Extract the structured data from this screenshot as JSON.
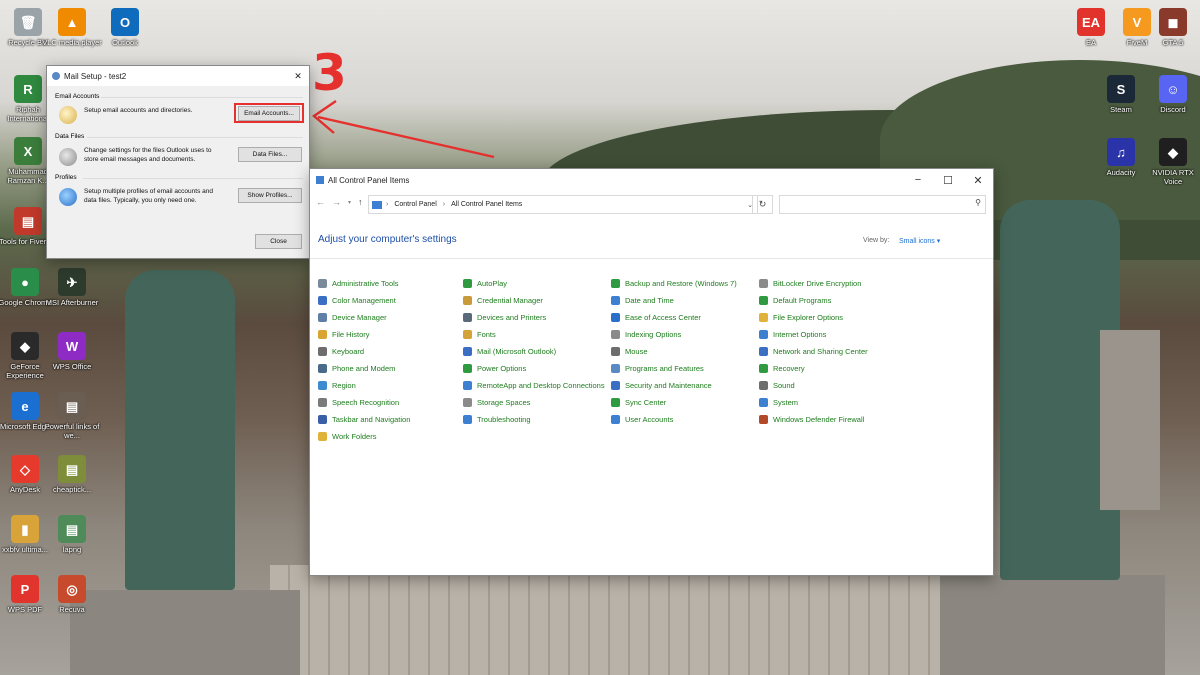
{
  "desktop": {
    "icons_left": [
      {
        "label": "Recycle Bin",
        "color": "#9aa3a8",
        "glyph": "🗑"
      },
      {
        "label": "VLC media player",
        "color": "#f08a00",
        "glyph": "▲"
      },
      {
        "label": "Outlook",
        "color": "#0f6cbd",
        "glyph": "O"
      },
      {
        "label": "Riphah International",
        "color": "#2f8a3f",
        "glyph": "R"
      },
      {
        "label": "Muhammad Ramzan K...",
        "color": "#3b7d3b",
        "glyph": "X"
      },
      {
        "label": "Tools for Fiverr ...",
        "color": "#c0392b",
        "glyph": "▤"
      },
      {
        "label": "Google Chrome",
        "color": "#2a8d4a",
        "glyph": "●"
      },
      {
        "label": "MSI Afterburner",
        "color": "#2d3b2d",
        "glyph": "✈"
      },
      {
        "label": "GeForce Experience",
        "color": "#2a2a2a",
        "glyph": "◆"
      },
      {
        "label": "WPS Office",
        "color": "#8e2bc4",
        "glyph": "W"
      },
      {
        "label": "Microsoft Edge",
        "color": "#1b6fd1",
        "glyph": "e"
      },
      {
        "label": "Powerful links of we...",
        "color": "#6a5d52",
        "glyph": "▤"
      },
      {
        "label": "AnyDesk",
        "color": "#e53a2c",
        "glyph": "◇"
      },
      {
        "label": "cheaptick...",
        "color": "#7e8d3a",
        "glyph": "▤"
      },
      {
        "label": "xxbfv ultima...",
        "color": "#d8a43a",
        "glyph": "▮"
      },
      {
        "label": "lapng",
        "color": "#4e8b58",
        "glyph": "▤"
      },
      {
        "label": "WPS PDF",
        "color": "#e0342c",
        "glyph": "P"
      },
      {
        "label": "Recuva",
        "color": "#c84a2c",
        "glyph": "◎"
      }
    ],
    "icons_right": [
      {
        "label": "EA",
        "color": "#e1322b",
        "glyph": "EA"
      },
      {
        "label": "FiveM",
        "color": "#f59a1e",
        "glyph": "V"
      },
      {
        "label": "GTA 5",
        "color": "#8a3a2a",
        "glyph": "◼"
      },
      {
        "label": "Steam",
        "color": "#1b2838",
        "glyph": "S"
      },
      {
        "label": "Discord",
        "color": "#5865f2",
        "glyph": "☺"
      },
      {
        "label": "Audacity",
        "color": "#2a34a8",
        "glyph": "♫"
      },
      {
        "label": "NVIDIA RTX Voice",
        "color": "#1f1f1f",
        "glyph": "◆"
      }
    ]
  },
  "annotation": {
    "number": "3",
    "color": "#e5302e"
  },
  "mail_setup": {
    "title": "Mail Setup - test2",
    "close_glyph": "✕",
    "email_accounts": {
      "heading": "Email Accounts",
      "desc": "Setup email accounts and directories.",
      "button": "Email Accounts..."
    },
    "data_files": {
      "heading": "Data Files",
      "desc_line1": "Change settings for the files Outlook uses to",
      "desc_line2": "store email messages and documents.",
      "button": "Data Files..."
    },
    "profiles": {
      "heading": "Profiles",
      "desc_line1": "Setup multiple profiles of email accounts and",
      "desc_line2": "data files. Typically, you only need one.",
      "button": "Show Profiles..."
    },
    "close_button": "Close"
  },
  "control_panel": {
    "title": "All Control Panel Items",
    "breadcrumb": [
      "Control Panel",
      "All Control Panel Items"
    ],
    "heading": "Adjust your computer's settings",
    "view_by_label": "View by:",
    "view_by_value": "Small icons ▾",
    "columns": [
      [
        {
          "label": "Administrative Tools",
          "color": "#7a8a9a"
        },
        {
          "label": "Color Management",
          "color": "#3a6fc4"
        },
        {
          "label": "Device Manager",
          "color": "#5f7fa8"
        },
        {
          "label": "File History",
          "color": "#d9a532"
        },
        {
          "label": "Keyboard",
          "color": "#6d6d6d"
        },
        {
          "label": "Phone and Modem",
          "color": "#4a6a8a"
        },
        {
          "label": "Region",
          "color": "#3d8ad1"
        },
        {
          "label": "Speech Recognition",
          "color": "#7a7a7a"
        },
        {
          "label": "Taskbar and Navigation",
          "color": "#3a5fa8"
        },
        {
          "label": "Work Folders",
          "color": "#e0b23a"
        }
      ],
      [
        {
          "label": "AutoPlay",
          "color": "#2f9a3f"
        },
        {
          "label": "Credential Manager",
          "color": "#c89a3a"
        },
        {
          "label": "Devices and Printers",
          "color": "#5a6a7a"
        },
        {
          "label": "Fonts",
          "color": "#d4a23a"
        },
        {
          "label": "Mail (Microsoft Outlook)",
          "color": "#3a6fc4"
        },
        {
          "label": "Power Options",
          "color": "#2f9a3f"
        },
        {
          "label": "RemoteApp and Desktop Connections",
          "color": "#3d7fd1"
        },
        {
          "label": "Storage Spaces",
          "color": "#8a8a8a"
        },
        {
          "label": "Troubleshooting",
          "color": "#3d7fd1"
        }
      ],
      [
        {
          "label": "Backup and Restore (Windows 7)",
          "color": "#2f9a3f"
        },
        {
          "label": "Date and Time",
          "color": "#3d7fd1"
        },
        {
          "label": "Ease of Access Center",
          "color": "#2a70c8"
        },
        {
          "label": "Indexing Options",
          "color": "#8a8a8a"
        },
        {
          "label": "Mouse",
          "color": "#6d6d6d"
        },
        {
          "label": "Programs and Features",
          "color": "#5a8ac4"
        },
        {
          "label": "Security and Maintenance",
          "color": "#3a6fc4"
        },
        {
          "label": "Sync Center",
          "color": "#2f9a3f"
        },
        {
          "label": "User Accounts",
          "color": "#3d7fd1"
        }
      ],
      [
        {
          "label": "BitLocker Drive Encryption",
          "color": "#8a8a8a"
        },
        {
          "label": "Default Programs",
          "color": "#2f9a3f"
        },
        {
          "label": "File Explorer Options",
          "color": "#e0b23a"
        },
        {
          "label": "Internet Options",
          "color": "#3d7fd1"
        },
        {
          "label": "Network and Sharing Center",
          "color": "#3a6fc4"
        },
        {
          "label": "Recovery",
          "color": "#2f9a3f"
        },
        {
          "label": "Sound",
          "color": "#6d6d6d"
        },
        {
          "label": "System",
          "color": "#3d7fd1"
        },
        {
          "label": "Windows Defender Firewall",
          "color": "#b24a2a"
        }
      ]
    ]
  }
}
